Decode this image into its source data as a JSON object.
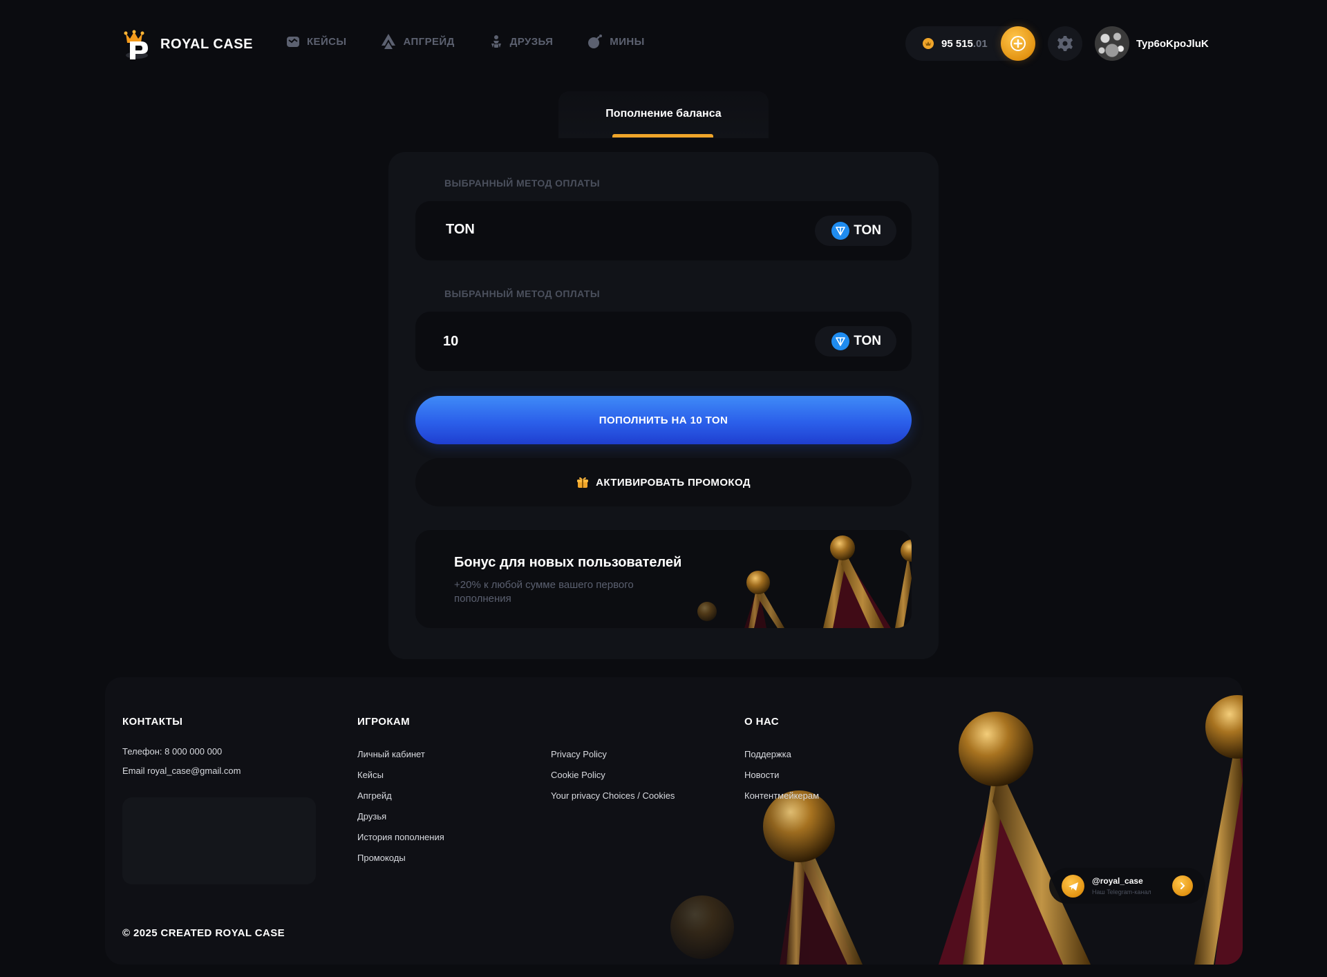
{
  "header": {
    "brand": "ROYAL CASE",
    "nav": [
      {
        "label": "КЕЙСЫ",
        "icon": "case-icon"
      },
      {
        "label": "АПГРЕЙД",
        "icon": "upgrade-icon"
      },
      {
        "label": "ДРУЗЬЯ",
        "icon": "friends-icon"
      },
      {
        "label": "МИНЫ",
        "icon": "bomb-icon"
      }
    ],
    "balance_int": "95 515",
    "balance_dec": ".01",
    "username": "Typ6oKpoJluK"
  },
  "tab": {
    "label": "Пополнение баланса"
  },
  "payment": {
    "method_label": "ВЫБРАННЫЙ МЕТОД ОПЛАТЫ",
    "method_value": "TON",
    "method_currency": "TON",
    "amount_label": "ВЫБРАННЫЙ МЕТОД ОПЛАТЫ",
    "amount_value": "10",
    "amount_currency": "TON",
    "deposit_button": "ПОПОЛНИТЬ НА 10 TON",
    "promo_button": "АКТИВИРОВАТЬ ПРОМОКОД"
  },
  "bonus": {
    "title": "Бонус для новых пользователей",
    "subtitle": "+20% к любой сумме вашего первого пополнения"
  },
  "footer": {
    "contacts_title": "КОНТАКТЫ",
    "phone": "Телефон: 8 000 000 000",
    "email": "Email royal_case@gmail.com",
    "players_title": "ИГРОКАМ",
    "players_links": [
      "Личный кабинет",
      "Кейсы",
      "Апгрейд",
      "Друзья",
      "История пополнения",
      "Промокоды"
    ],
    "policy_links": [
      "Privacy Policy",
      "Cookie Policy",
      "Your privacy Choices / Cookies"
    ],
    "about_title": "О НАС",
    "about_links": [
      "Поддержка",
      "Новости",
      "Контентмейкерам"
    ],
    "copyright": "© 2025 CREATED ROYAL CASE",
    "telegram_name": "@royal_case",
    "telegram_sub": "Наш Telegram-канал"
  },
  "colors": {
    "background": "#0b0c10",
    "card": "#111318",
    "accent_gold": "#f0a52a",
    "accent_blue": "#2b5fea",
    "ton_blue": "#1f8cf0"
  }
}
